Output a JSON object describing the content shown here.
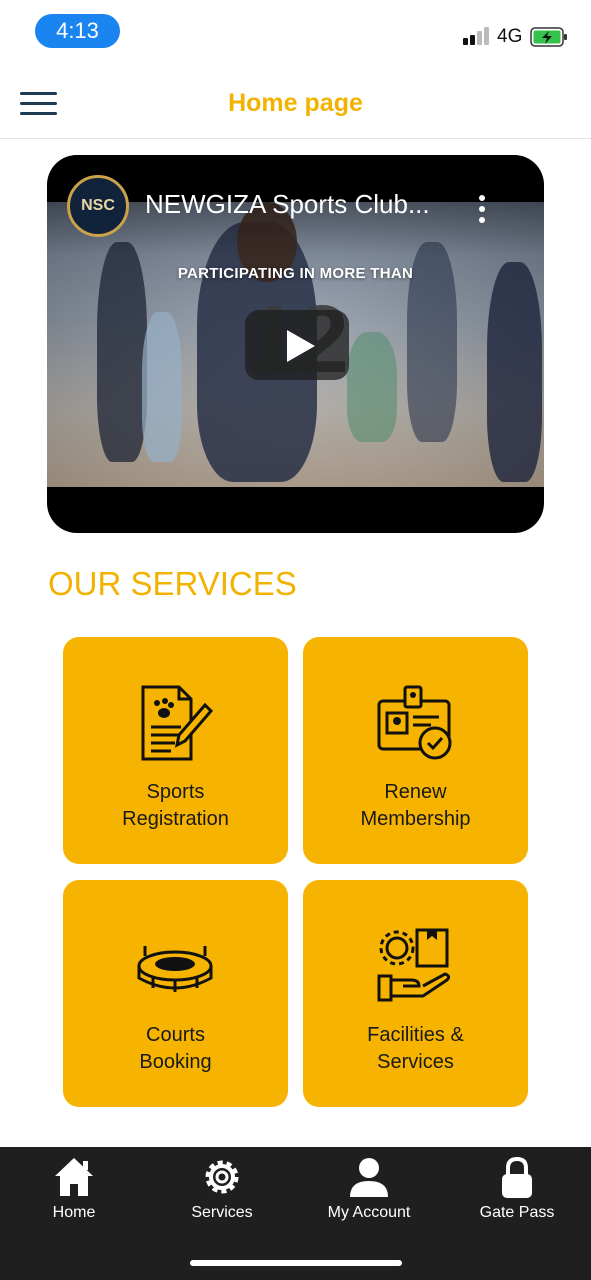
{
  "status_bar": {
    "time": "4:13",
    "network": "4G"
  },
  "header": {
    "title": "Home page"
  },
  "video": {
    "title": "NEWGIZA Sports Club...",
    "overlay_text": "PARTICIPATING IN MORE THAN",
    "overlay_number": "12"
  },
  "services": {
    "title": "OUR SERVICES",
    "items": [
      {
        "label": "Sports\nRegistration",
        "icon": "sports-registration-icon"
      },
      {
        "label": "Renew\nMembership",
        "icon": "membership-card-icon"
      },
      {
        "label": "Courts\nBooking",
        "icon": "stadium-icon"
      },
      {
        "label": "Facilities &\nServices",
        "icon": "facilities-hand-icon"
      }
    ]
  },
  "bottom_nav": {
    "items": [
      {
        "label": "Home",
        "icon": "home-icon"
      },
      {
        "label": "Services",
        "icon": "gear-icon"
      },
      {
        "label": "My Account",
        "icon": "user-icon"
      },
      {
        "label": "Gate Pass",
        "icon": "lock-icon"
      }
    ]
  },
  "colors": {
    "accent": "#f2b200",
    "tile": "#f6b400",
    "nav_bg": "#1f1f1f",
    "time_pill": "#1a84f0"
  }
}
